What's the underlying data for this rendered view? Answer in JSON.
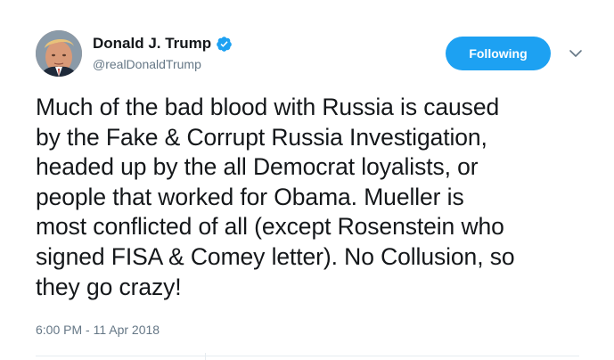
{
  "author": {
    "display_name": "Donald J. Trump",
    "handle": "@realDonaldTrump",
    "verified": true,
    "avatar_icon": "profile-photo"
  },
  "actions": {
    "follow_label": "Following",
    "menu_icon": "chevron-down-icon"
  },
  "tweet": {
    "lines": [
      "Much of the bad blood with Russia is caused",
      "by the Fake & Corrupt Russia Investigation,",
      "headed up by the all Democrat loyalists, or",
      "people that worked for Obama. Mueller is",
      "most conflicted of all (except Rosenstein who",
      "signed FISA & Comey letter). No Collusion, so",
      "they go crazy!"
    ],
    "timestamp": "6:00 PM - 11 Apr 2018"
  },
  "colors": {
    "accent": "#1da1f2",
    "text": "#14171a",
    "secondary_text": "#657786",
    "divider": "#e6ecf0"
  }
}
